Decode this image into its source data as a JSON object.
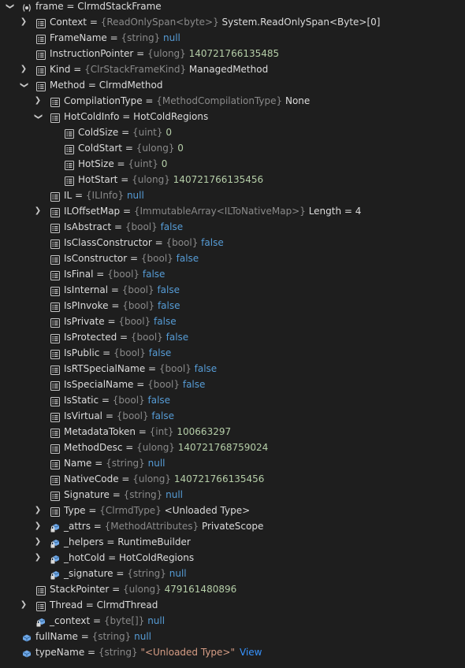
{
  "rows": [
    {
      "depth": 0,
      "expander": "open",
      "icon": "watch",
      "name": "frame",
      "type": "",
      "value": "ClrmdStackFrame",
      "vclass": "plain"
    },
    {
      "depth": 1,
      "expander": "closed",
      "icon": "property",
      "name": "Context",
      "type": "{ReadOnlySpan<byte>}",
      "value": "System.ReadOnlySpan<Byte>[0]",
      "vclass": "plain"
    },
    {
      "depth": 1,
      "expander": "none",
      "icon": "property",
      "name": "FrameName",
      "type": "{string}",
      "value": "null",
      "vclass": "kw"
    },
    {
      "depth": 1,
      "expander": "none",
      "icon": "property",
      "name": "InstructionPointer",
      "type": "{ulong}",
      "value": "140721766135485",
      "vclass": "num"
    },
    {
      "depth": 1,
      "expander": "closed",
      "icon": "property",
      "name": "Kind",
      "type": "{ClrStackFrameKind}",
      "value": "ManagedMethod",
      "vclass": "plain"
    },
    {
      "depth": 1,
      "expander": "open",
      "icon": "property",
      "name": "Method",
      "type": "",
      "value": "ClrmdMethod",
      "vclass": "plain"
    },
    {
      "depth": 2,
      "expander": "closed",
      "icon": "property",
      "name": "CompilationType",
      "type": "{MethodCompilationType}",
      "value": "None",
      "vclass": "plain"
    },
    {
      "depth": 2,
      "expander": "open",
      "icon": "property",
      "name": "HotColdInfo",
      "type": "",
      "value": "HotColdRegions",
      "vclass": "plain"
    },
    {
      "depth": 3,
      "expander": "none",
      "icon": "property",
      "name": "ColdSize",
      "type": "{uint}",
      "value": "0",
      "vclass": "num"
    },
    {
      "depth": 3,
      "expander": "none",
      "icon": "property",
      "name": "ColdStart",
      "type": "{ulong}",
      "value": "0",
      "vclass": "num"
    },
    {
      "depth": 3,
      "expander": "none",
      "icon": "property",
      "name": "HotSize",
      "type": "{uint}",
      "value": "0",
      "vclass": "num"
    },
    {
      "depth": 3,
      "expander": "none",
      "icon": "property",
      "name": "HotStart",
      "type": "{ulong}",
      "value": "140721766135456",
      "vclass": "num"
    },
    {
      "depth": 2,
      "expander": "none",
      "icon": "property",
      "name": "IL",
      "type": "{ILInfo}",
      "value": "null",
      "vclass": "kw"
    },
    {
      "depth": 2,
      "expander": "closed",
      "icon": "property",
      "name": "ILOffsetMap",
      "type": "{ImmutableArray<ILToNativeMap>}",
      "value": "Length = 4",
      "vclass": "plain"
    },
    {
      "depth": 2,
      "expander": "none",
      "icon": "property",
      "name": "IsAbstract",
      "type": "{bool}",
      "value": "false",
      "vclass": "kw"
    },
    {
      "depth": 2,
      "expander": "none",
      "icon": "property",
      "name": "IsClassConstructor",
      "type": "{bool}",
      "value": "false",
      "vclass": "kw"
    },
    {
      "depth": 2,
      "expander": "none",
      "icon": "property",
      "name": "IsConstructor",
      "type": "{bool}",
      "value": "false",
      "vclass": "kw"
    },
    {
      "depth": 2,
      "expander": "none",
      "icon": "property",
      "name": "IsFinal",
      "type": "{bool}",
      "value": "false",
      "vclass": "kw"
    },
    {
      "depth": 2,
      "expander": "none",
      "icon": "property",
      "name": "IsInternal",
      "type": "{bool}",
      "value": "false",
      "vclass": "kw"
    },
    {
      "depth": 2,
      "expander": "none",
      "icon": "property",
      "name": "IsPInvoke",
      "type": "{bool}",
      "value": "false",
      "vclass": "kw"
    },
    {
      "depth": 2,
      "expander": "none",
      "icon": "property",
      "name": "IsPrivate",
      "type": "{bool}",
      "value": "false",
      "vclass": "kw"
    },
    {
      "depth": 2,
      "expander": "none",
      "icon": "property",
      "name": "IsProtected",
      "type": "{bool}",
      "value": "false",
      "vclass": "kw"
    },
    {
      "depth": 2,
      "expander": "none",
      "icon": "property",
      "name": "IsPublic",
      "type": "{bool}",
      "value": "false",
      "vclass": "kw"
    },
    {
      "depth": 2,
      "expander": "none",
      "icon": "property",
      "name": "IsRTSpecialName",
      "type": "{bool}",
      "value": "false",
      "vclass": "kw"
    },
    {
      "depth": 2,
      "expander": "none",
      "icon": "property",
      "name": "IsSpecialName",
      "type": "{bool}",
      "value": "false",
      "vclass": "kw"
    },
    {
      "depth": 2,
      "expander": "none",
      "icon": "property",
      "name": "IsStatic",
      "type": "{bool}",
      "value": "false",
      "vclass": "kw"
    },
    {
      "depth": 2,
      "expander": "none",
      "icon": "property",
      "name": "IsVirtual",
      "type": "{bool}",
      "value": "false",
      "vclass": "kw"
    },
    {
      "depth": 2,
      "expander": "none",
      "icon": "property",
      "name": "MetadataToken",
      "type": "{int}",
      "value": "100663297",
      "vclass": "num"
    },
    {
      "depth": 2,
      "expander": "none",
      "icon": "property",
      "name": "MethodDesc",
      "type": "{ulong}",
      "value": "140721768759024",
      "vclass": "num"
    },
    {
      "depth": 2,
      "expander": "none",
      "icon": "property",
      "name": "Name",
      "type": "{string}",
      "value": "null",
      "vclass": "kw"
    },
    {
      "depth": 2,
      "expander": "none",
      "icon": "property",
      "name": "NativeCode",
      "type": "{ulong}",
      "value": "140721766135456",
      "vclass": "num"
    },
    {
      "depth": 2,
      "expander": "none",
      "icon": "property",
      "name": "Signature",
      "type": "{string}",
      "value": "null",
      "vclass": "kw"
    },
    {
      "depth": 2,
      "expander": "closed",
      "icon": "property",
      "name": "Type",
      "type": "{ClrmdType}",
      "value": "<Unloaded Type>",
      "vclass": "plain"
    },
    {
      "depth": 2,
      "expander": "closed",
      "icon": "private-field",
      "name": "_attrs",
      "type": "{MethodAttributes}",
      "value": "PrivateScope",
      "vclass": "plain"
    },
    {
      "depth": 2,
      "expander": "closed",
      "icon": "private-field",
      "name": "_helpers",
      "type": "",
      "value": "RuntimeBuilder",
      "vclass": "plain"
    },
    {
      "depth": 2,
      "expander": "closed",
      "icon": "private-field",
      "name": "_hotCold",
      "type": "",
      "value": "HotColdRegions",
      "vclass": "plain"
    },
    {
      "depth": 2,
      "expander": "none",
      "icon": "private-field",
      "name": "_signature",
      "type": "{string}",
      "value": "null",
      "vclass": "kw"
    },
    {
      "depth": 1,
      "expander": "none",
      "icon": "property",
      "name": "StackPointer",
      "type": "{ulong}",
      "value": "479161480896",
      "vclass": "num"
    },
    {
      "depth": 1,
      "expander": "closed",
      "icon": "property",
      "name": "Thread",
      "type": "",
      "value": "ClrmdThread",
      "vclass": "plain"
    },
    {
      "depth": 1,
      "expander": "none",
      "icon": "private-field",
      "name": "_context",
      "type": "{byte[]}",
      "value": "null",
      "vclass": "kw"
    },
    {
      "depth": 0,
      "expander": "none",
      "icon": "field",
      "name": "fullName",
      "type": "{string}",
      "value": "null",
      "vclass": "kw"
    },
    {
      "depth": 0,
      "expander": "none",
      "icon": "field",
      "name": "typeName",
      "type": "{string}",
      "value": "\"<Unloaded Type>\"",
      "vclass": "str",
      "link": "View"
    }
  ],
  "equals": "=",
  "colors": {
    "background": "#1e1e1e",
    "keyword": "#569cd6",
    "number": "#b5cea8",
    "string": "#d69d85",
    "type": "#8a8a8a",
    "link": "#3794ff"
  }
}
